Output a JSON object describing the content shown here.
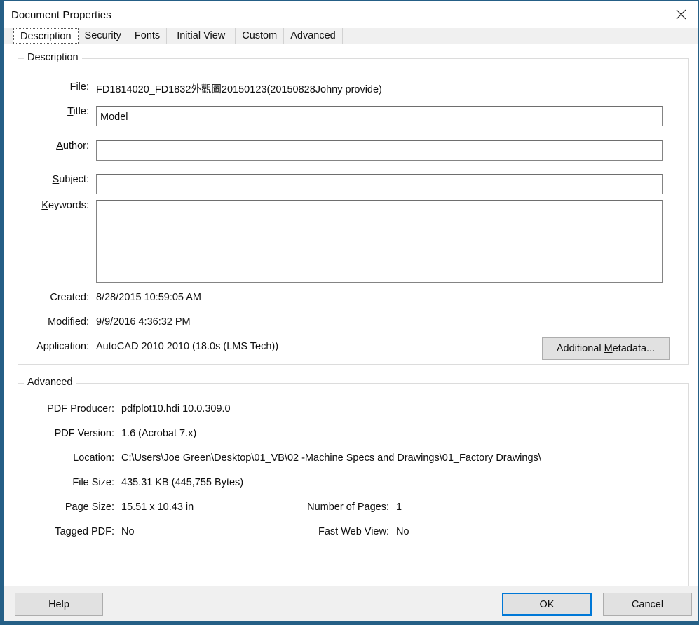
{
  "window": {
    "title": "Document Properties",
    "close_icon": "close-icon"
  },
  "tabs": [
    {
      "label": "Description",
      "selected": true
    },
    {
      "label": "Security",
      "selected": false
    },
    {
      "label": "Fonts",
      "selected": false
    },
    {
      "label": "Initial View",
      "selected": false
    },
    {
      "label": "Custom",
      "selected": false
    },
    {
      "label": "Advanced",
      "selected": false
    }
  ],
  "description": {
    "legend": "Description",
    "file": {
      "label": "File:",
      "value": "FD1814020_FD1832外觀圖20150123(20150828Johny provide)"
    },
    "title": {
      "label_pre": "",
      "label_accel": "T",
      "label_post": "itle:",
      "value": "Model",
      "placeholder": ""
    },
    "author": {
      "label_pre": "",
      "label_accel": "A",
      "label_post": "uthor:",
      "value": "",
      "placeholder": ""
    },
    "subject": {
      "label_pre": "",
      "label_accel": "S",
      "label_post": "ubject:",
      "value": "",
      "placeholder": ""
    },
    "keywords": {
      "label_pre": "",
      "label_accel": "K",
      "label_post": "eywords:",
      "value": "",
      "placeholder": ""
    },
    "created": {
      "label": "Created:",
      "value": "8/28/2015 10:59:05 AM"
    },
    "modified": {
      "label": "Modified:",
      "value": "9/9/2016 4:36:32 PM"
    },
    "application": {
      "label": "Application:",
      "value": "AutoCAD 2010 2010 (18.0s (LMS Tech))"
    },
    "additional_metadata_button": {
      "pre": "Additional ",
      "accel": "M",
      "post": "etadata..."
    }
  },
  "advanced": {
    "legend": "Advanced",
    "pdf_producer": {
      "label": "PDF Producer:",
      "value": "pdfplot10.hdi 10.0.309.0"
    },
    "pdf_version": {
      "label": "PDF Version:",
      "value": "1.6 (Acrobat 7.x)"
    },
    "location": {
      "label": "Location:",
      "value": "C:\\Users\\Joe Green\\Desktop\\01_VB\\02 -Machine Specs and Drawings\\01_Factory Drawings\\"
    },
    "file_size": {
      "label": "File Size:",
      "value": "435.31 KB (445,755 Bytes)"
    },
    "page_size": {
      "label": "Page Size:",
      "value": "15.51 x 10.43 in"
    },
    "tagged_pdf": {
      "label": "Tagged PDF:",
      "value": "No"
    },
    "number_of_pages": {
      "label": "Number of Pages:",
      "value": "1"
    },
    "fast_web_view": {
      "label": "Fast Web View:",
      "value": "No"
    }
  },
  "footer": {
    "help": "Help",
    "ok": "OK",
    "cancel": "Cancel"
  },
  "colors": {
    "window_frame": "#255f86",
    "focus_border": "#0078d7",
    "button_face": "#e1e1e1",
    "tabstrip": "#f0f0f0"
  }
}
